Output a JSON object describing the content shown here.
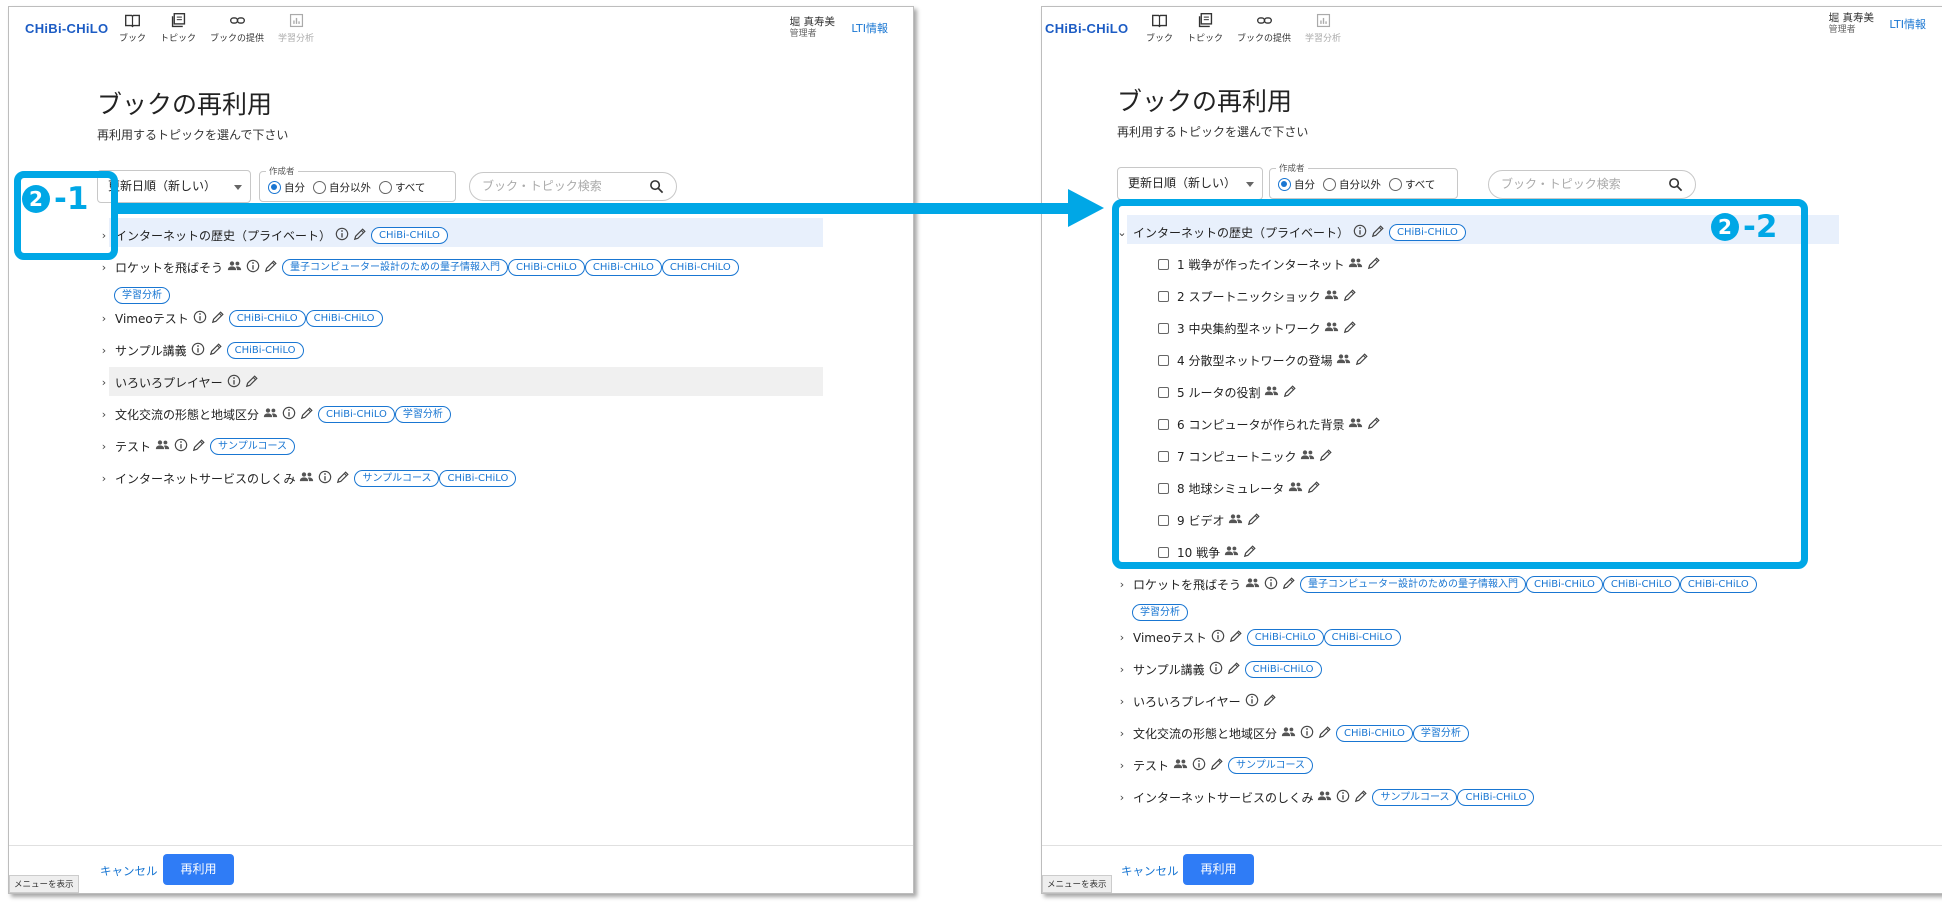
{
  "app": {
    "logo": "CHiBi-CHiLO",
    "nav": [
      {
        "label": "ブック",
        "icon": "book-icon",
        "disabled": false
      },
      {
        "label": "トピック",
        "icon": "topic-icon",
        "disabled": false
      },
      {
        "label": "ブックの提供",
        "icon": "link-icon",
        "disabled": false
      },
      {
        "label": "学習分析",
        "icon": "analytics-icon",
        "disabled": true
      }
    ],
    "user_name": "堀 真寿美",
    "user_role": "管理者",
    "lti_link": "LTI情報"
  },
  "page": {
    "title": "ブックの再利用",
    "subtitle": "再利用するトピックを選んで下さい"
  },
  "filters": {
    "sort_label": "更新日順（新しい）",
    "creator_legend": "作成者",
    "creator_options": [
      "自分",
      "自分以外",
      "すべて"
    ],
    "creator_selected": "自分",
    "search_placeholder": "ブック・トピック検索"
  },
  "books": [
    {
      "title": "インターネットの歴史（プライベート）",
      "shared": false,
      "info": true,
      "chips": [
        "CHiBi-CHiLO"
      ]
    },
    {
      "title": "ロケットを飛ばそう",
      "shared": true,
      "info": true,
      "chips": [
        "量子コンピューター設計のための量子情報入門",
        "CHiBi-CHiLO",
        "CHiBi-CHiLO",
        "CHiBi-CHiLO",
        "学習分析"
      ]
    },
    {
      "title": "Vimeoテスト",
      "shared": false,
      "info": true,
      "chips": [
        "CHiBi-CHiLO",
        "CHiBi-CHiLO"
      ]
    },
    {
      "title": "サンプル講義",
      "shared": false,
      "info": true,
      "chips": [
        "CHiBi-CHiLO"
      ]
    },
    {
      "title": "いろいろプレイヤー",
      "shared": false,
      "info": true,
      "chips": []
    },
    {
      "title": "文化交流の形態と地域区分",
      "shared": true,
      "info": true,
      "chips": [
        "CHiBi-CHiLO",
        "学習分析"
      ]
    },
    {
      "title": "テスト",
      "shared": true,
      "info": true,
      "chips": [
        "サンプルコース"
      ]
    },
    {
      "title": "インターネットサービスのしくみ",
      "shared": true,
      "info": true,
      "chips": [
        "サンプルコース",
        "CHiBi-CHiLO"
      ]
    }
  ],
  "topics": [
    {
      "label": "1 戦争が作ったインターネット"
    },
    {
      "label": "2 スプートニックショック"
    },
    {
      "label": "3 中央集約型ネットワーク"
    },
    {
      "label": "4 分散型ネットワークの登場"
    },
    {
      "label": "5 ルータの役割"
    },
    {
      "label": "6 コンピュータが作られた背景"
    },
    {
      "label": "7 コンピュートニック"
    },
    {
      "label": "8 地球シミュレータ"
    },
    {
      "label": "9 ビデオ"
    },
    {
      "label": "10 戦争"
    }
  ],
  "footer": {
    "cancel_label": "キャンセル",
    "reuse_label": "再利用",
    "menu_tag": "メニューを表示"
  },
  "callouts": {
    "left_num": "2",
    "left_suffix": "-1",
    "right_num": "2",
    "right_suffix": "-2",
    "color": "#00a7e6"
  },
  "colors": {
    "accent": "#1976d2",
    "primary_button": "#2f7cf6",
    "callout": "#00a7e6"
  }
}
